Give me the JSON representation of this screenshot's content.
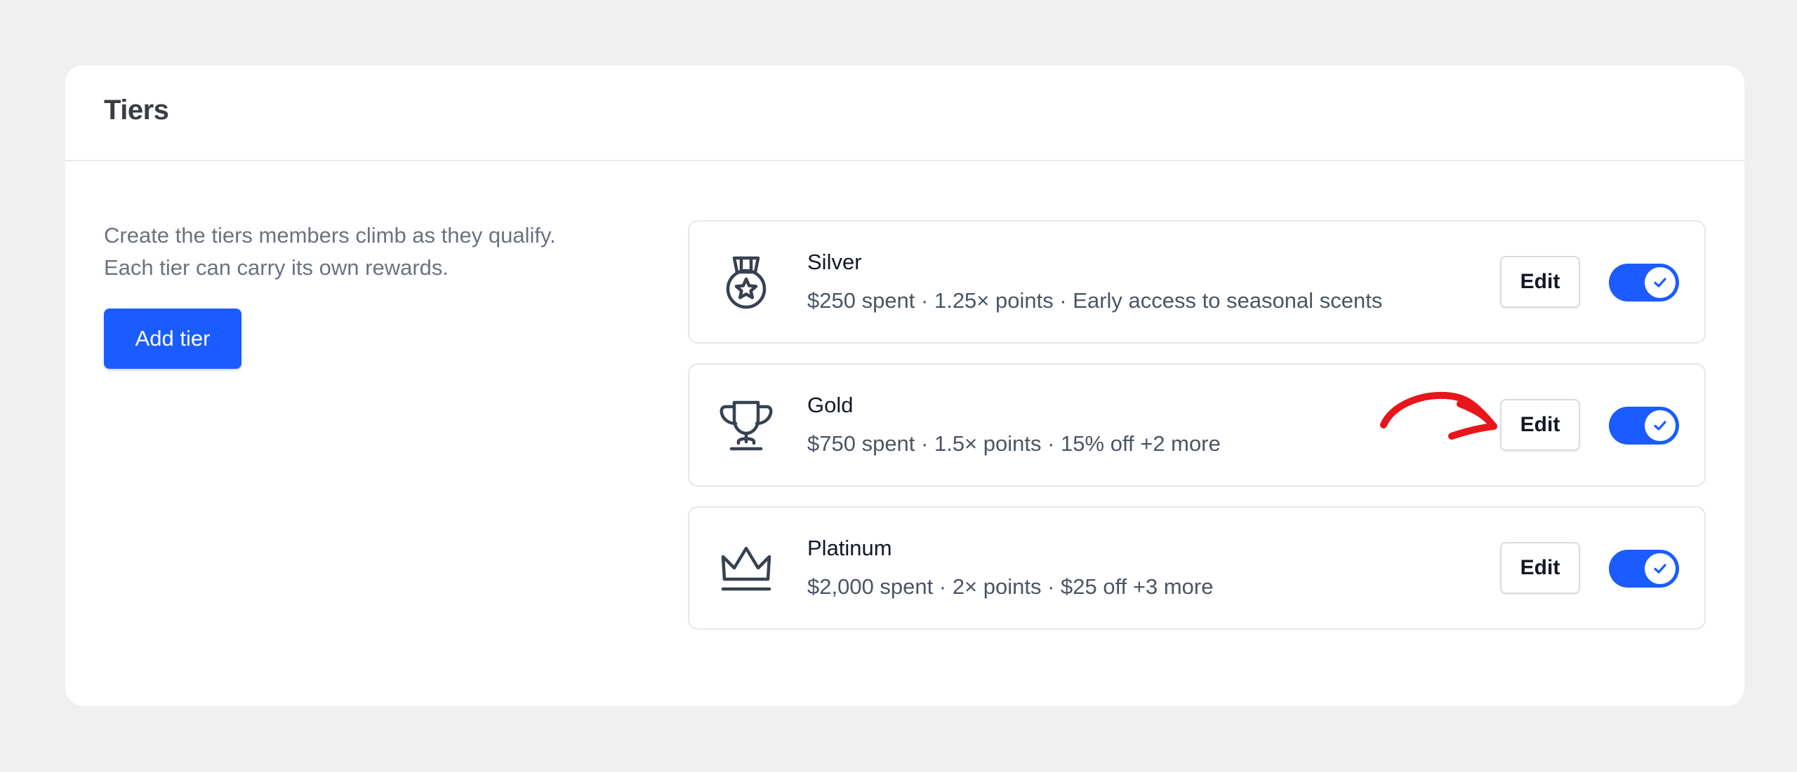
{
  "panel": {
    "title": "Tiers",
    "intro_line1": "Create the tiers members climb as they qualify.",
    "intro_line2": "Each tier can carry its own rewards.",
    "add_button_label": "Add tier"
  },
  "tiers": [
    {
      "name": "Silver",
      "description": "$250 spent · 1.25× points · Early access to seasonal scents",
      "icon": "medal-icon",
      "edit_label": "Edit",
      "enabled": true
    },
    {
      "name": "Gold",
      "description": "$750 spent · 1.5× points · 15% off +2 more",
      "icon": "trophy-icon",
      "edit_label": "Edit",
      "enabled": true
    },
    {
      "name": "Platinum",
      "description": "$2,000 spent · 2× points · $25 off +3 more",
      "icon": "crown-icon",
      "edit_label": "Edit",
      "enabled": true
    }
  ],
  "colors": {
    "accent": "#1a5cff",
    "annotation": "#e8151b",
    "background": "#f0f0f0"
  }
}
